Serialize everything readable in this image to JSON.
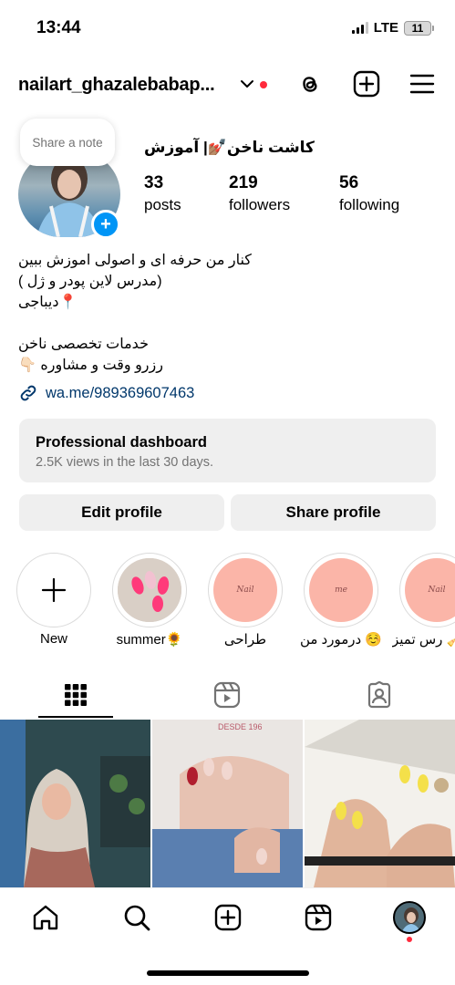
{
  "status_bar": {
    "time": "13:44",
    "network": "LTE",
    "battery": "11"
  },
  "header": {
    "username": "nailart_ghazalebabap...",
    "icons": [
      "chevron-down-icon",
      "threads-icon",
      "create-post-icon",
      "menu-icon"
    ]
  },
  "profile": {
    "note_placeholder": "Share a note",
    "display_name": "کاشت ناخن💅🏽| آموزش",
    "stats": [
      {
        "value": "33",
        "label": "posts"
      },
      {
        "value": "219",
        "label": "followers"
      },
      {
        "value": "56",
        "label": "following"
      }
    ]
  },
  "bio": {
    "lines": [
      "کنار من حرفه ای و اصولی اموزش ببین",
      "(مدرس لاین پودر و ژل )",
      "📍دیباجی",
      "",
      "خدمات تخصصی ناخن",
      "رزرو وقت و مشاوره 👇🏻"
    ],
    "link": "wa.me/989369607463"
  },
  "dashboard": {
    "title": "Professional dashboard",
    "subtitle": "2.5K views in the last 30 days."
  },
  "buttons": {
    "edit": "Edit profile",
    "share": "Share profile"
  },
  "highlights": [
    {
      "label": "New",
      "cover_text": ""
    },
    {
      "label": "summer🌻",
      "cover_text": ""
    },
    {
      "label": "طراحی",
      "cover_text": "Nail"
    },
    {
      "label": "درمورد من ☺️",
      "cover_text": "me"
    },
    {
      "label": "رس تمیز 🧹",
      "cover_text": "Nail"
    }
  ],
  "tabs": [
    "grid-icon",
    "reels-icon",
    "tagged-icon"
  ],
  "grid": {
    "posts": [
      {
        "name": "post-portrait"
      },
      {
        "name": "post-red-french-nails",
        "text": "DESDE 196"
      },
      {
        "name": "post-yellow-nails"
      }
    ]
  },
  "bottom_nav": [
    "home-icon",
    "search-icon",
    "create-icon",
    "reels-icon",
    "profile-avatar"
  ],
  "colors": {
    "accent": "#0095f6",
    "link": "#00376b",
    "notification": "#ff2a3c",
    "surface": "#efefef"
  }
}
